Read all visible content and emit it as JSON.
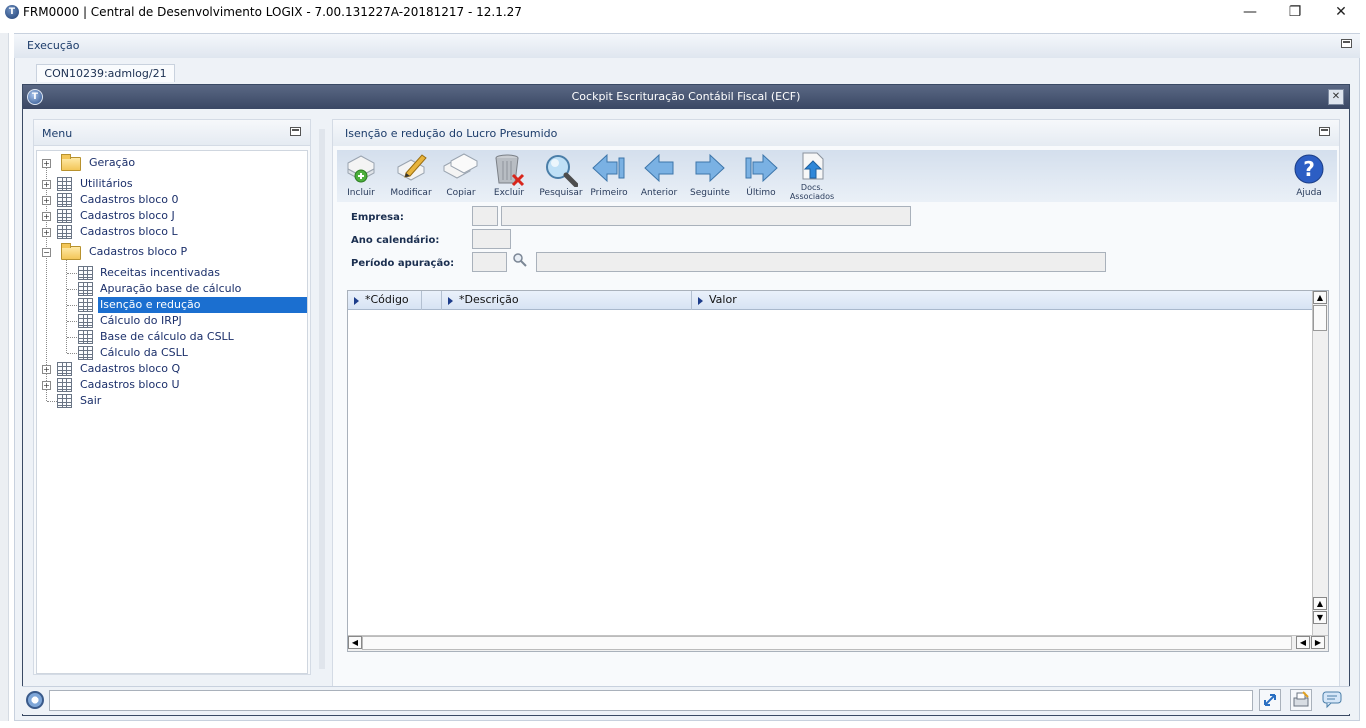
{
  "window": {
    "title": "FRM0000 | Central de Desenvolvimento LOGIX  -  7.00.131227A-20181217  -  12.1.27",
    "minimize": "—",
    "restore": "❐",
    "close": "✕"
  },
  "execution_bar": {
    "label": "Execução"
  },
  "tab": {
    "label": "CON10239:admlog/21"
  },
  "cockpit": {
    "title": "Cockpit Escrituração Contábil Fiscal (ECF)",
    "close": "✕"
  },
  "menu": {
    "title": "Menu",
    "items": [
      {
        "label": "Geração"
      },
      {
        "label": "Utilitários"
      },
      {
        "label": "Cadastros bloco 0"
      },
      {
        "label": "Cadastros bloco J"
      },
      {
        "label": "Cadastros bloco L"
      },
      {
        "label": "Cadastros bloco P"
      },
      {
        "label": "Receitas incentivadas"
      },
      {
        "label": "Apuração base de cálculo"
      },
      {
        "label": "Isenção e redução"
      },
      {
        "label": "Cálculo do IRPJ"
      },
      {
        "label": "Base de cálculo da CSLL"
      },
      {
        "label": "Cálculo da CSLL"
      },
      {
        "label": "Cadastros bloco Q"
      },
      {
        "label": "Cadastros bloco U"
      },
      {
        "label": "Sair"
      }
    ]
  },
  "main": {
    "title": "Isenção e redução do Lucro Presumido",
    "toolbar": {
      "incluir": "Incluir",
      "modificar": "Modificar",
      "copiar": "Copiar",
      "excluir": "Excluir",
      "pesquisar": "Pesquisar",
      "primeiro": "Primeiro",
      "anterior": "Anterior",
      "seguinte": "Seguinte",
      "ultimo": "Último",
      "docs1": "Docs.",
      "docs2": "Associados",
      "ajuda": "Ajuda"
    },
    "form": {
      "empresa_label": "Empresa:",
      "empresa_code": "",
      "empresa_name": "",
      "ano_label": "Ano calendário:",
      "ano_value": "",
      "periodo_label": "Período apuração:",
      "periodo_code": "",
      "periodo_desc": ""
    },
    "grid": {
      "columns": [
        "*Código",
        "*Descrição",
        "Valor"
      ],
      "rows": []
    }
  }
}
